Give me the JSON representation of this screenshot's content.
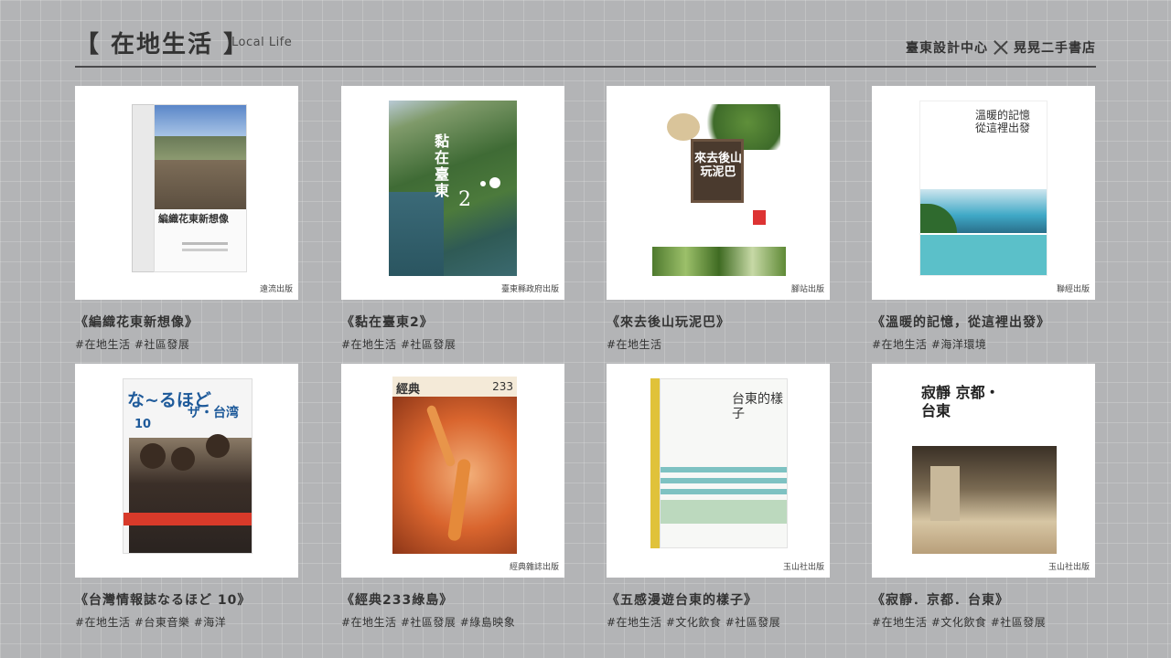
{
  "header": {
    "title": "【 在地生活 】",
    "subtitle": "Local Life",
    "collab_left": "臺東設計中心",
    "collab_right": "晃晃二手書店"
  },
  "books": [
    {
      "title": "《編織花東新想像》",
      "tags": "#在地生活 #社區發展",
      "publisher": "遠流出版",
      "cover_text": "編織花東新想像"
    },
    {
      "title": "《黏在臺東2》",
      "tags": "#在地生活 #社區發展",
      "publisher": "臺東縣政府出版",
      "cover_text": "黏在臺東",
      "cover_number": "2"
    },
    {
      "title": "《來去後山玩泥巴》",
      "tags": "#在地生活",
      "publisher": "腳站出版",
      "cover_text": "來去後山玩泥巴"
    },
    {
      "title": "《溫暖的記憶，從這裡出發》",
      "tags": "#在地生活 #海洋環境",
      "publisher": "聯經出版",
      "cover_text": "溫暖的記憶 從這裡出發"
    },
    {
      "title": "《台灣情報誌なるほど 10》",
      "tags": "#在地生活 #台東音樂 #海洋",
      "publisher": "",
      "cover_text": "な~るほど",
      "cover_sub": "ザ・台湾",
      "cover_number": "10"
    },
    {
      "title": "《經典233綠島》",
      "tags": "#在地生活 #社區發展 #綠島映象",
      "publisher": "經典雜誌出版",
      "cover_text": "經典",
      "cover_number": "233"
    },
    {
      "title": "《五感漫遊台東的樣子》",
      "tags": "#在地生活 #文化飲食 #社區發展",
      "publisher": "玉山社出版",
      "cover_text": "台東的樣子"
    },
    {
      "title": "《寂靜．京都．台東》",
      "tags": "#在地生活 #文化飲食 #社區發展",
      "publisher": "玉山社出版",
      "cover_text": "寂靜 京都・台東"
    }
  ]
}
